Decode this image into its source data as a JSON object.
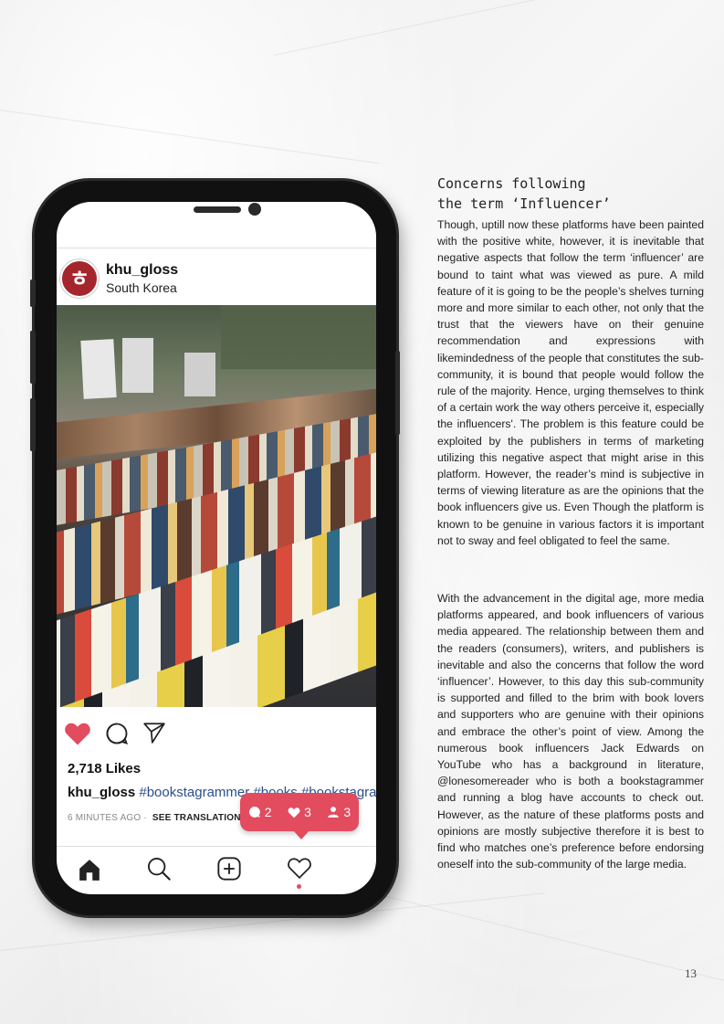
{
  "post": {
    "username": "khu_gloss",
    "location": "South Korea",
    "avatar_letter": "ㅎ",
    "likes": "2,718 Likes",
    "caption_user": "khu_gloss",
    "caption_tags": "#bookstagrammer #books #bookstagram",
    "time": "6 MINUTES AGO",
    "separator": "·",
    "translation": "SEE TRANSLATION"
  },
  "notification": {
    "comments": "2",
    "likes": "3",
    "followers": "3"
  },
  "icons": [
    "heart-icon",
    "comment-icon",
    "share-icon",
    "home-icon",
    "search-icon",
    "add-icon",
    "activity-heart-icon"
  ],
  "colors": {
    "accent": "#e34b5f",
    "hashtag": "#2b4f8a",
    "avatar": "#a4262c"
  },
  "article": {
    "heading_line1": "Concerns following",
    "heading_line2": "the term ‘Influencer’",
    "paragraph1": "Though, uptill now these platforms have been painted with the positive white, however, it is inevitable that negative aspects that follow the term ‘influencer’ are bound to taint what was viewed as pure. A mild feature of it is going to be the people’s shelves turning more and more similar to each other, not only that the trust that the viewers have on their genuine recommendation and expressions with likemindedness of the people that constitutes the sub-community, it is bound that people would follow the rule of the majority. Hence, urging themselves to think of a certain work the way others perceive it, especially the influencers'. The problem is this feature could be exploited by the publishers in terms of marketing utilizing this negative aspect that might arise in this platform. However, the reader’s mind is subjective in terms of viewing literature as are the opinions that the book influencers give us. Even Though the platform is known to be genuine in various factors it is important not to sway and feel obligated to feel the same.",
    "paragraph2": "With the advancement in the digital age, more media platforms appeared, and book influencers of various media appeared. The relationship between them and the readers (consumers), writers, and publishers is inevitable and also the concerns that follow the word ‘influencer’. However, to this day this sub-community is supported and filled to the brim with book lovers and supporters who are genuine with their opinions and embrace the other’s point of view. Among the numerous book influencers Jack Edwards on YouTube who has a background in literature, @lonesomereader who is both a bookstagrammer and running a blog have accounts to check out. However, as the nature of these platforms posts and opinions are mostly subjective therefore it is best to find who matches one’s preference before endorsing oneself into the sub-community of the large media."
  },
  "page_number": "13"
}
